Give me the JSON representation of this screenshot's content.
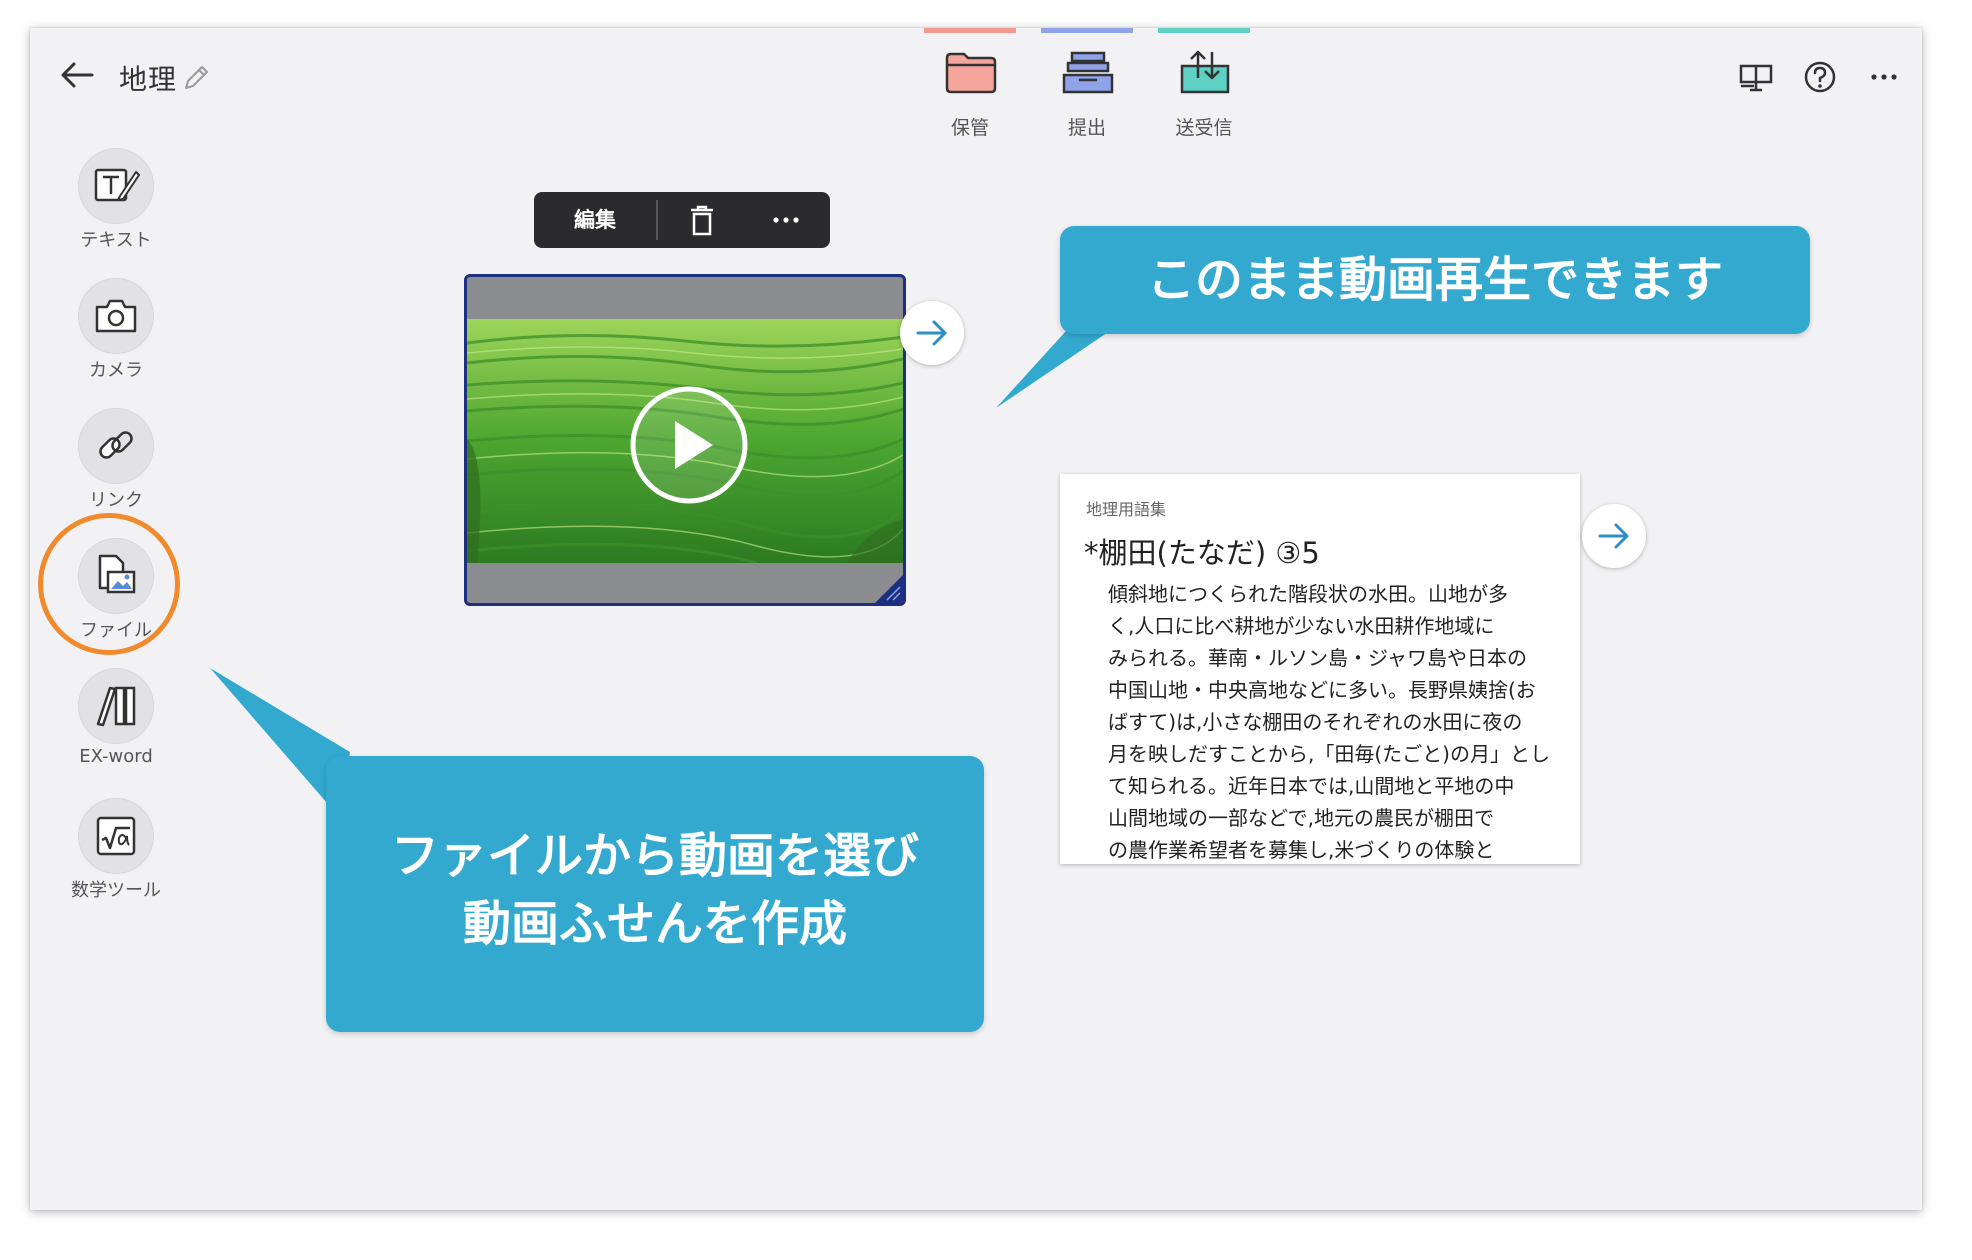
{
  "header": {
    "title": "地理",
    "nav": [
      {
        "label": "保管",
        "icon": "folder-icon",
        "accent": "#f29a8e"
      },
      {
        "label": "提出",
        "icon": "tray-icon",
        "accent": "#8fa3e8"
      },
      {
        "label": "送受信",
        "icon": "transfer-icon",
        "accent": "#5fd1c4"
      }
    ]
  },
  "sidebar": {
    "items": [
      {
        "label": "テキスト",
        "icon": "text-tool-icon"
      },
      {
        "label": "カメラ",
        "icon": "camera-icon"
      },
      {
        "label": "リンク",
        "icon": "link-icon"
      },
      {
        "label": "ファイル",
        "icon": "file-image-icon",
        "highlighted": true
      },
      {
        "label": "EX-word",
        "icon": "ex-word-icon"
      },
      {
        "label": "数学ツール",
        "icon": "math-tool-icon"
      }
    ]
  },
  "card_toolbar": {
    "edit_label": "編集"
  },
  "text_card": {
    "caption": "地理用語集",
    "heading": "*棚田(たなだ) ③5",
    "lines": [
      "傾斜地につくられた階段状の水田。山地が多",
      "く,人口に比べ耕地が少ない水田耕作地域に",
      "みられる。華南・ルソン島・ジャワ島や日本の",
      "中国山地・中央高地などに多い。長野県姨捨(お",
      "ばすて)は,小さな棚田のそれぞれの水田に夜の",
      "月を映しだすことから,「田毎(たごと)の月」とし",
      "て知られる。近年日本では,山間地と平地の中",
      "山間地域の一部などで,地元の農民が棚田で",
      "の農作業希望者を募集し,米づくりの体験と"
    ]
  },
  "callouts": {
    "top": "このまま動画再生できます",
    "bottom_line1": "ファイルから動画を選び",
    "bottom_line2": "動画ふせんを作成"
  },
  "colors": {
    "callout": "#33a9d0",
    "highlight": "#f08a2c",
    "card_border": "#1d2f80",
    "link_arrow": "#2d8fc4"
  }
}
